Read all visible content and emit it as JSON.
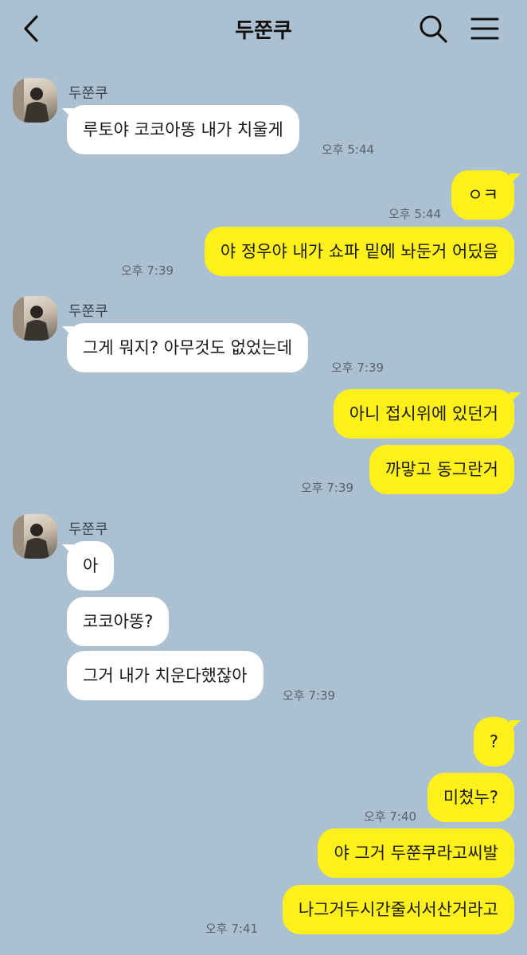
{
  "header": {
    "title": "두쭌쿠",
    "back_icon": "chevron-left-icon",
    "search_icon": "search-icon",
    "menu_icon": "hamburger-menu-icon"
  },
  "contact": {
    "name": "두쭌쿠"
  },
  "messages": [
    {
      "side": "in",
      "text": "루토야 코코아똥 내가 치울게",
      "time": "오후 5:44"
    },
    {
      "side": "out",
      "text": "ㅇㅋ",
      "time": "오후 5:44"
    },
    {
      "side": "out",
      "text": "야 정우야 내가 쇼파 밑에 놔둔거 어딨음",
      "time": "오후 7:39"
    },
    {
      "side": "in",
      "text": "그게 뭐지? 아무것도 없었는데",
      "time": "오후 7:39"
    },
    {
      "side": "out",
      "text": "아니 접시위에 있던거",
      "time": ""
    },
    {
      "side": "out",
      "text": "까맣고 동그란거",
      "time": "오후 7:39"
    },
    {
      "side": "in",
      "text": "아",
      "time": ""
    },
    {
      "side": "in",
      "text": "코코아똥?",
      "time": ""
    },
    {
      "side": "in",
      "text": "그거 내가 치운다했잖아",
      "time": "오후 7:39"
    },
    {
      "side": "out",
      "text": "?",
      "time": ""
    },
    {
      "side": "out",
      "text": "미쳤누?",
      "time": "오후 7:40"
    },
    {
      "side": "out",
      "text": "야 그거 두쭌쿠라고씨발",
      "time": ""
    },
    {
      "side": "out",
      "text": "나그거두시간줄서서산거라고",
      "time": "오후 7:41"
    }
  ],
  "colors": {
    "background": "#abc1d1",
    "incoming_bubble": "#ffffff",
    "outgoing_bubble": "#fef01b"
  }
}
